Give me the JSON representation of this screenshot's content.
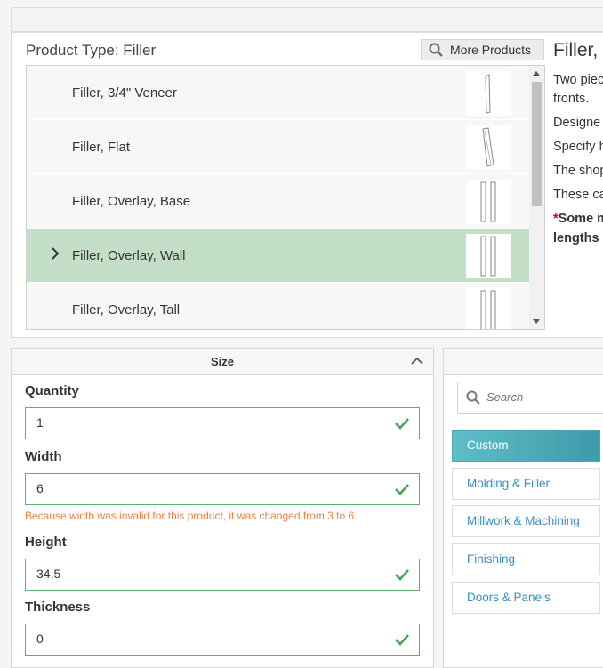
{
  "product_type": "Product Type: Filler",
  "more_products_label": "More Products",
  "products": [
    {
      "label": "Filler, 3/4\" Veneer",
      "selected": false
    },
    {
      "label": "Filler, Flat",
      "selected": false
    },
    {
      "label": "Filler, Overlay, Base",
      "selected": false
    },
    {
      "label": "Filler, Overlay, Wall",
      "selected": true
    },
    {
      "label": "Filler, Overlay, Tall",
      "selected": false
    }
  ],
  "description": {
    "title": "Filler,",
    "lines": [
      "Two piec",
      "fronts.",
      "Designe",
      "Specify h",
      "The shop",
      "These ca"
    ],
    "bold_star": "*",
    "bold_lines": [
      "Some m",
      "lengths"
    ]
  },
  "size_panel": {
    "title": "Size",
    "fields": [
      {
        "label": "Quantity",
        "value": "1"
      },
      {
        "label": "Width",
        "value": "6"
      },
      {
        "label": "Height",
        "value": "34.5"
      },
      {
        "label": "Thickness",
        "value": "0"
      }
    ],
    "width_warning": "Because width was invalid for this product, it was changed from 3 to 6."
  },
  "categories": {
    "search_placeholder": "Search",
    "items": [
      "Custom",
      "Molding & Filler",
      "Millwork & Machining",
      "Finishing",
      "Doors & Panels"
    ],
    "active": "Custom"
  },
  "colors": {
    "selected_row": "#c3dfc8",
    "valid_border": "#5cae6c",
    "warning": "#e3854a",
    "active_category": "#4aa8b4",
    "link": "#3a8fbf"
  }
}
